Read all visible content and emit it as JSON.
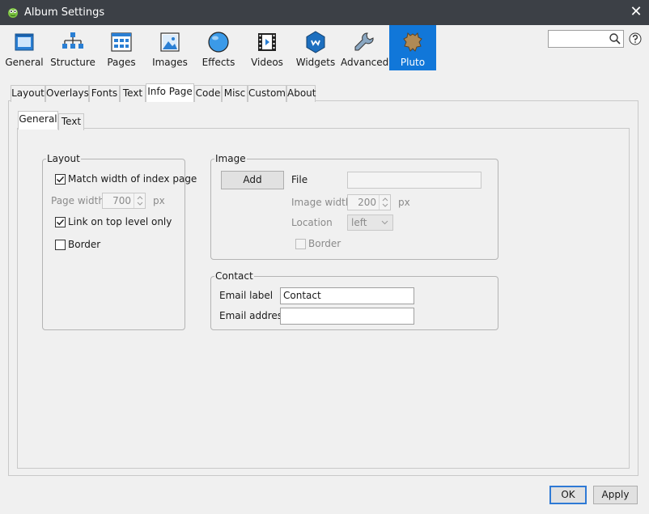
{
  "window": {
    "title": "Album Settings",
    "close_glyph": "✕"
  },
  "toolbar": {
    "items": [
      {
        "label": "General",
        "icon": "window-icon"
      },
      {
        "label": "Structure",
        "icon": "hierarchy-icon"
      },
      {
        "label": "Pages",
        "icon": "grid-page-icon"
      },
      {
        "label": "Images",
        "icon": "picture-icon"
      },
      {
        "label": "Effects",
        "icon": "sphere-icon"
      },
      {
        "label": "Videos",
        "icon": "film-icon"
      },
      {
        "label": "Widgets",
        "icon": "widget-hexagon-icon"
      },
      {
        "label": "Advanced",
        "icon": "wrench-icon"
      },
      {
        "label": "Pluto",
        "icon": "hide-skin-icon",
        "active": true
      }
    ],
    "search_value": ""
  },
  "tabs": [
    "Layout",
    "Overlays",
    "Fonts",
    "Text",
    "Info Page",
    "Code",
    "Misc",
    "Custom",
    "About"
  ],
  "selected_tab": "Info Page",
  "subtabs": [
    "General",
    "Text"
  ],
  "selected_subtab": "General",
  "layout_group": {
    "title": "Layout",
    "match_width": {
      "label": "Match width of index page",
      "checked": true
    },
    "page_width": {
      "label": "Page width",
      "value": "700",
      "unit": "px",
      "enabled": false
    },
    "link_top": {
      "label": "Link on top level only",
      "checked": true
    },
    "border": {
      "label": "Border",
      "checked": false
    }
  },
  "image_group": {
    "title": "Image",
    "add_label": "Add",
    "file_label": "File",
    "file_value": "",
    "image_width": {
      "label": "Image width",
      "value": "200",
      "unit": "px",
      "enabled": false
    },
    "location": {
      "label": "Location",
      "value": "left",
      "enabled": false
    },
    "border": {
      "label": "Border",
      "checked": false,
      "enabled": false
    }
  },
  "contact_group": {
    "title": "Contact",
    "email_label": {
      "label": "Email label",
      "value": "Contact"
    },
    "email_address": {
      "label": "Email address",
      "value": ""
    }
  },
  "buttons": {
    "ok": "OK",
    "apply": "Apply"
  },
  "colors": {
    "titlebar": "#3c4046",
    "accent": "#1177d9",
    "background": "#f0f0f0"
  }
}
